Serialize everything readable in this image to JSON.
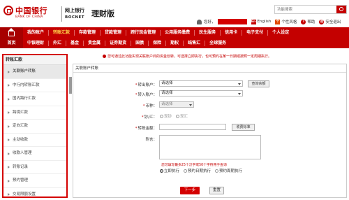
{
  "header": {
    "logo_cn": "中国银行",
    "logo_en": "BANK OF CHINA",
    "brand_cn": "网上银行",
    "brand_en": "BOCNET",
    "brand_title": "理财版",
    "search_placeholder": "功能搜索",
    "greeting": "您好，",
    "links": [
      {
        "icon": "En",
        "label": "English"
      },
      {
        "icon": "个",
        "label": "个性风格"
      },
      {
        "icon": "?",
        "label": "帮助"
      },
      {
        "icon": "退",
        "label": "安全退出"
      }
    ]
  },
  "nav": {
    "home_label": "首页",
    "row1": [
      "我的账户",
      "转账汇款",
      "存款管理",
      "贷款管理",
      "跨行现金管理",
      "公用服务缴费",
      "民生服务",
      "信用卡",
      "电子支付",
      "个人设定"
    ],
    "row2": [
      "中银理财",
      "外汇",
      "基金",
      "贵金属",
      "证券期货",
      "国债",
      "保险",
      "期权",
      "结售汇",
      "全球服务"
    ],
    "active": "转账汇款"
  },
  "sidebar": {
    "title": "转账汇款",
    "items": [
      "关联账户转账",
      "中行内转账汇款",
      "国内跨行汇款",
      "跨境汇款",
      "定向汇款",
      "主动收款",
      "收款人管理",
      "转账记录",
      "预约管理",
      "交易限额设置"
    ],
    "active_index": 0
  },
  "main": {
    "notice": "您可通过此功能实现关联账户间的资金划转，可选择立即执行，也可预约在某一日期或按照一定周期执行。",
    "panel_title": "关联账户转账",
    "form": {
      "from_label": "转出账户：",
      "from_value": "请选择",
      "balance_btn": "查询余额",
      "to_label": "转入账户：",
      "to_value": "请选择",
      "currency_label": "币种：",
      "currency_value": "请选择",
      "cashflag_label": "钞/汇：",
      "cash_option": "现钞",
      "remit_option": "现汇",
      "amount_label": "转账金额：",
      "fee_btn": "收费标准",
      "memo_label": "附言：",
      "memo_hint": "您可填写最多25个汉字或50个字符用于查询",
      "exec_options": [
        "立即执行",
        "预约日期执行",
        "预约周期执行"
      ],
      "exec_selected": 0
    },
    "next_btn": "下一步",
    "reset_btn": "重置"
  }
}
